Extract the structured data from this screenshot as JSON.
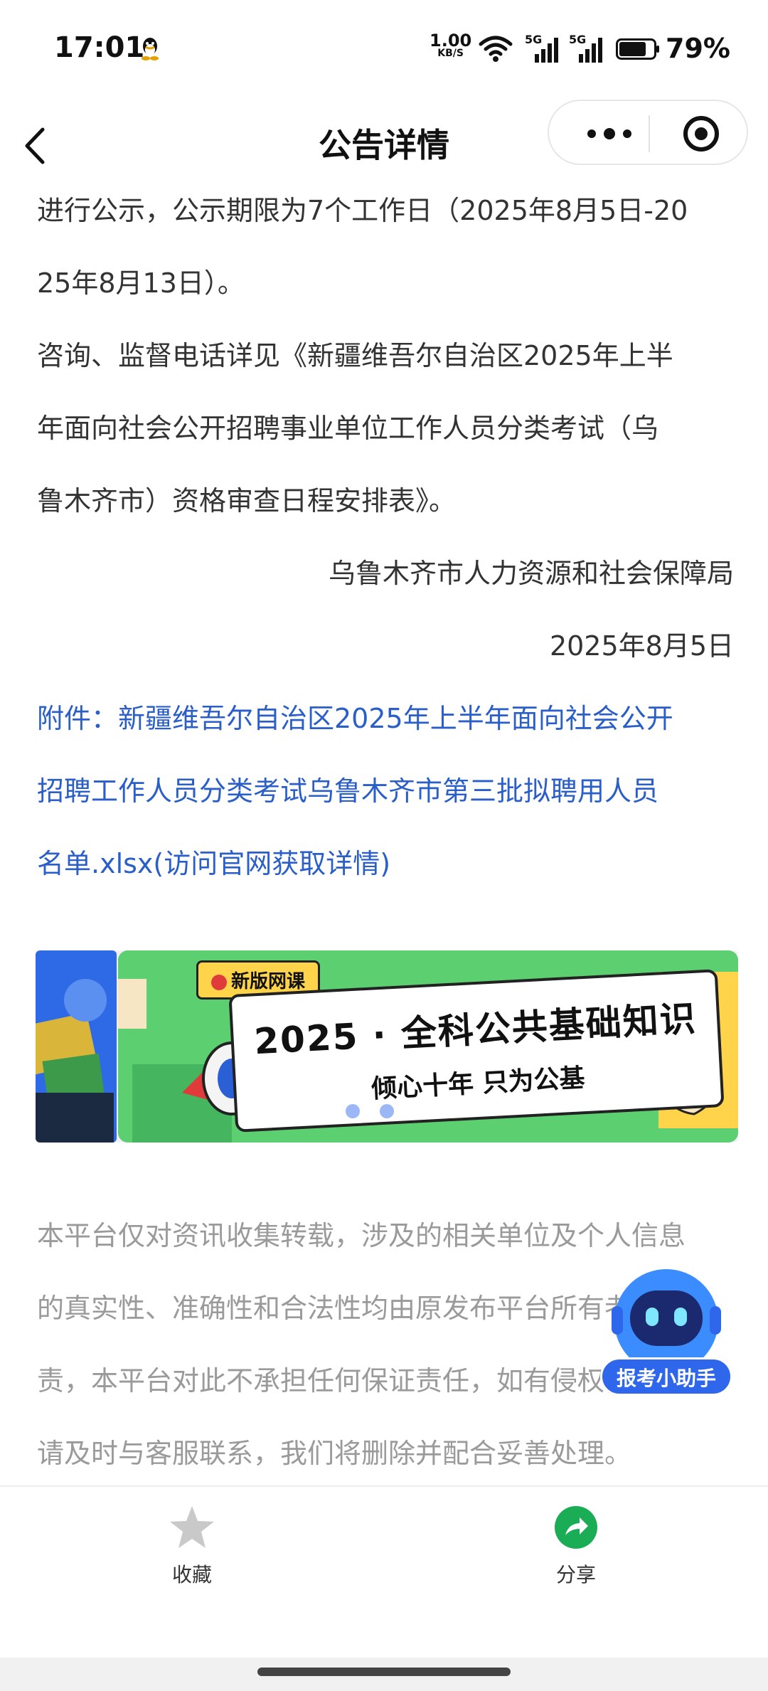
{
  "status_bar": {
    "time": "17:01",
    "net_speed_value": "1.00",
    "net_speed_unit": "KB/S",
    "signal1_label": "5G",
    "signal2_label": "5G",
    "battery_percent": "79%",
    "battery_level": 0.79
  },
  "nav": {
    "title": "公告详情"
  },
  "article": {
    "lines": [
      "进行公示，公示期限为7个工作日（2025年8月5日-20",
      "25年8月13日）。",
      "咨询、监督电话详见《新疆维吾尔自治区2025年上半",
      "年面向社会公开招聘事业单位工作人员分类考试（乌",
      "鲁木齐市）资格审查日程安排表》。"
    ],
    "issuer": "乌鲁木齐市人力资源和社会保障局",
    "date": "2025年8月5日",
    "attachment_lines": [
      "附件：新疆维吾尔自治区2025年上半年面向社会公开",
      "招聘工作人员分类考试乌鲁木齐市第三批拟聘用人员",
      "名单.xlsx(访问官网获取详情)"
    ]
  },
  "banner": {
    "tag": "新版网课",
    "title": "2025 · 全科公共基础知识",
    "subtitle": "倾心十年 只为公基",
    "active_dot": 0
  },
  "disclaimer": {
    "lines": [
      "本平台仅对资讯收集转载，涉及的相关单位及个人信息",
      "的真实性、准确性和合法性均由原发布平台所有者负",
      "责，本平台对此不承担任何保证责任，如有侵权，",
      "请及时与客服联系，我们将删除并配合妥善处理。"
    ]
  },
  "assistant": {
    "label": "报考小助手"
  },
  "bottom_bar": {
    "favorite_label": "收藏",
    "share_label": "分享"
  },
  "colors": {
    "link": "#2a5ec9",
    "share_green": "#1aad55",
    "assistant_blue": "#2e66ec"
  }
}
